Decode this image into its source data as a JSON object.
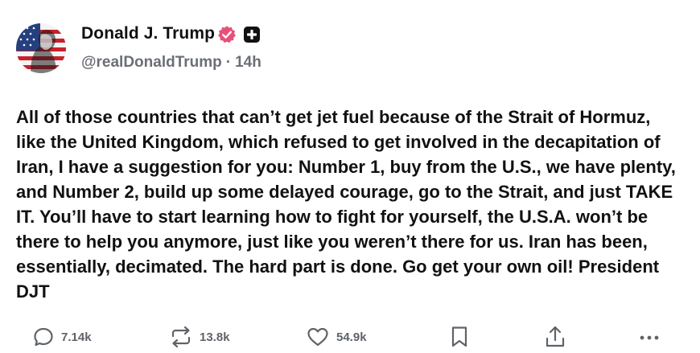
{
  "author": {
    "display_name": "Donald J. Trump",
    "handle": "@realDonaldTrump",
    "separator": "·",
    "time_ago": "14h"
  },
  "icons": {
    "avatar": "flag-portrait-avatar",
    "verified": "verified-badge-icon",
    "premium": "plus-badge-icon",
    "reply": "speech-bubble-icon",
    "repost": "repost-arrows-icon",
    "like": "heart-icon",
    "bookmark": "bookmark-icon",
    "share": "share-upload-icon",
    "more": "ellipsis-icon"
  },
  "colors": {
    "verified_badge": "#e8507a",
    "text": "#111111",
    "muted": "#6b6f75"
  },
  "post": {
    "text": "All of those countries that can’t get jet fuel because of the Strait of Hormuz, like the United Kingdom, which refused to get involved in the decapitation of Iran, I have a suggestion for you: Number 1, buy from the U.S., we have plenty, and Number 2, build up some delayed courage, go to the Strait, and just TAKE IT. You’ll have to start learning how to fight for yourself, the U.S.A. won’t be there to help you anymore, just like you weren’t there for us. Iran has been, essentially, decimated. The hard part is done. Go get your own oil! President DJT"
  },
  "stats": {
    "replies": "7.14k",
    "reposts": "13.8k",
    "likes": "54.9k"
  }
}
